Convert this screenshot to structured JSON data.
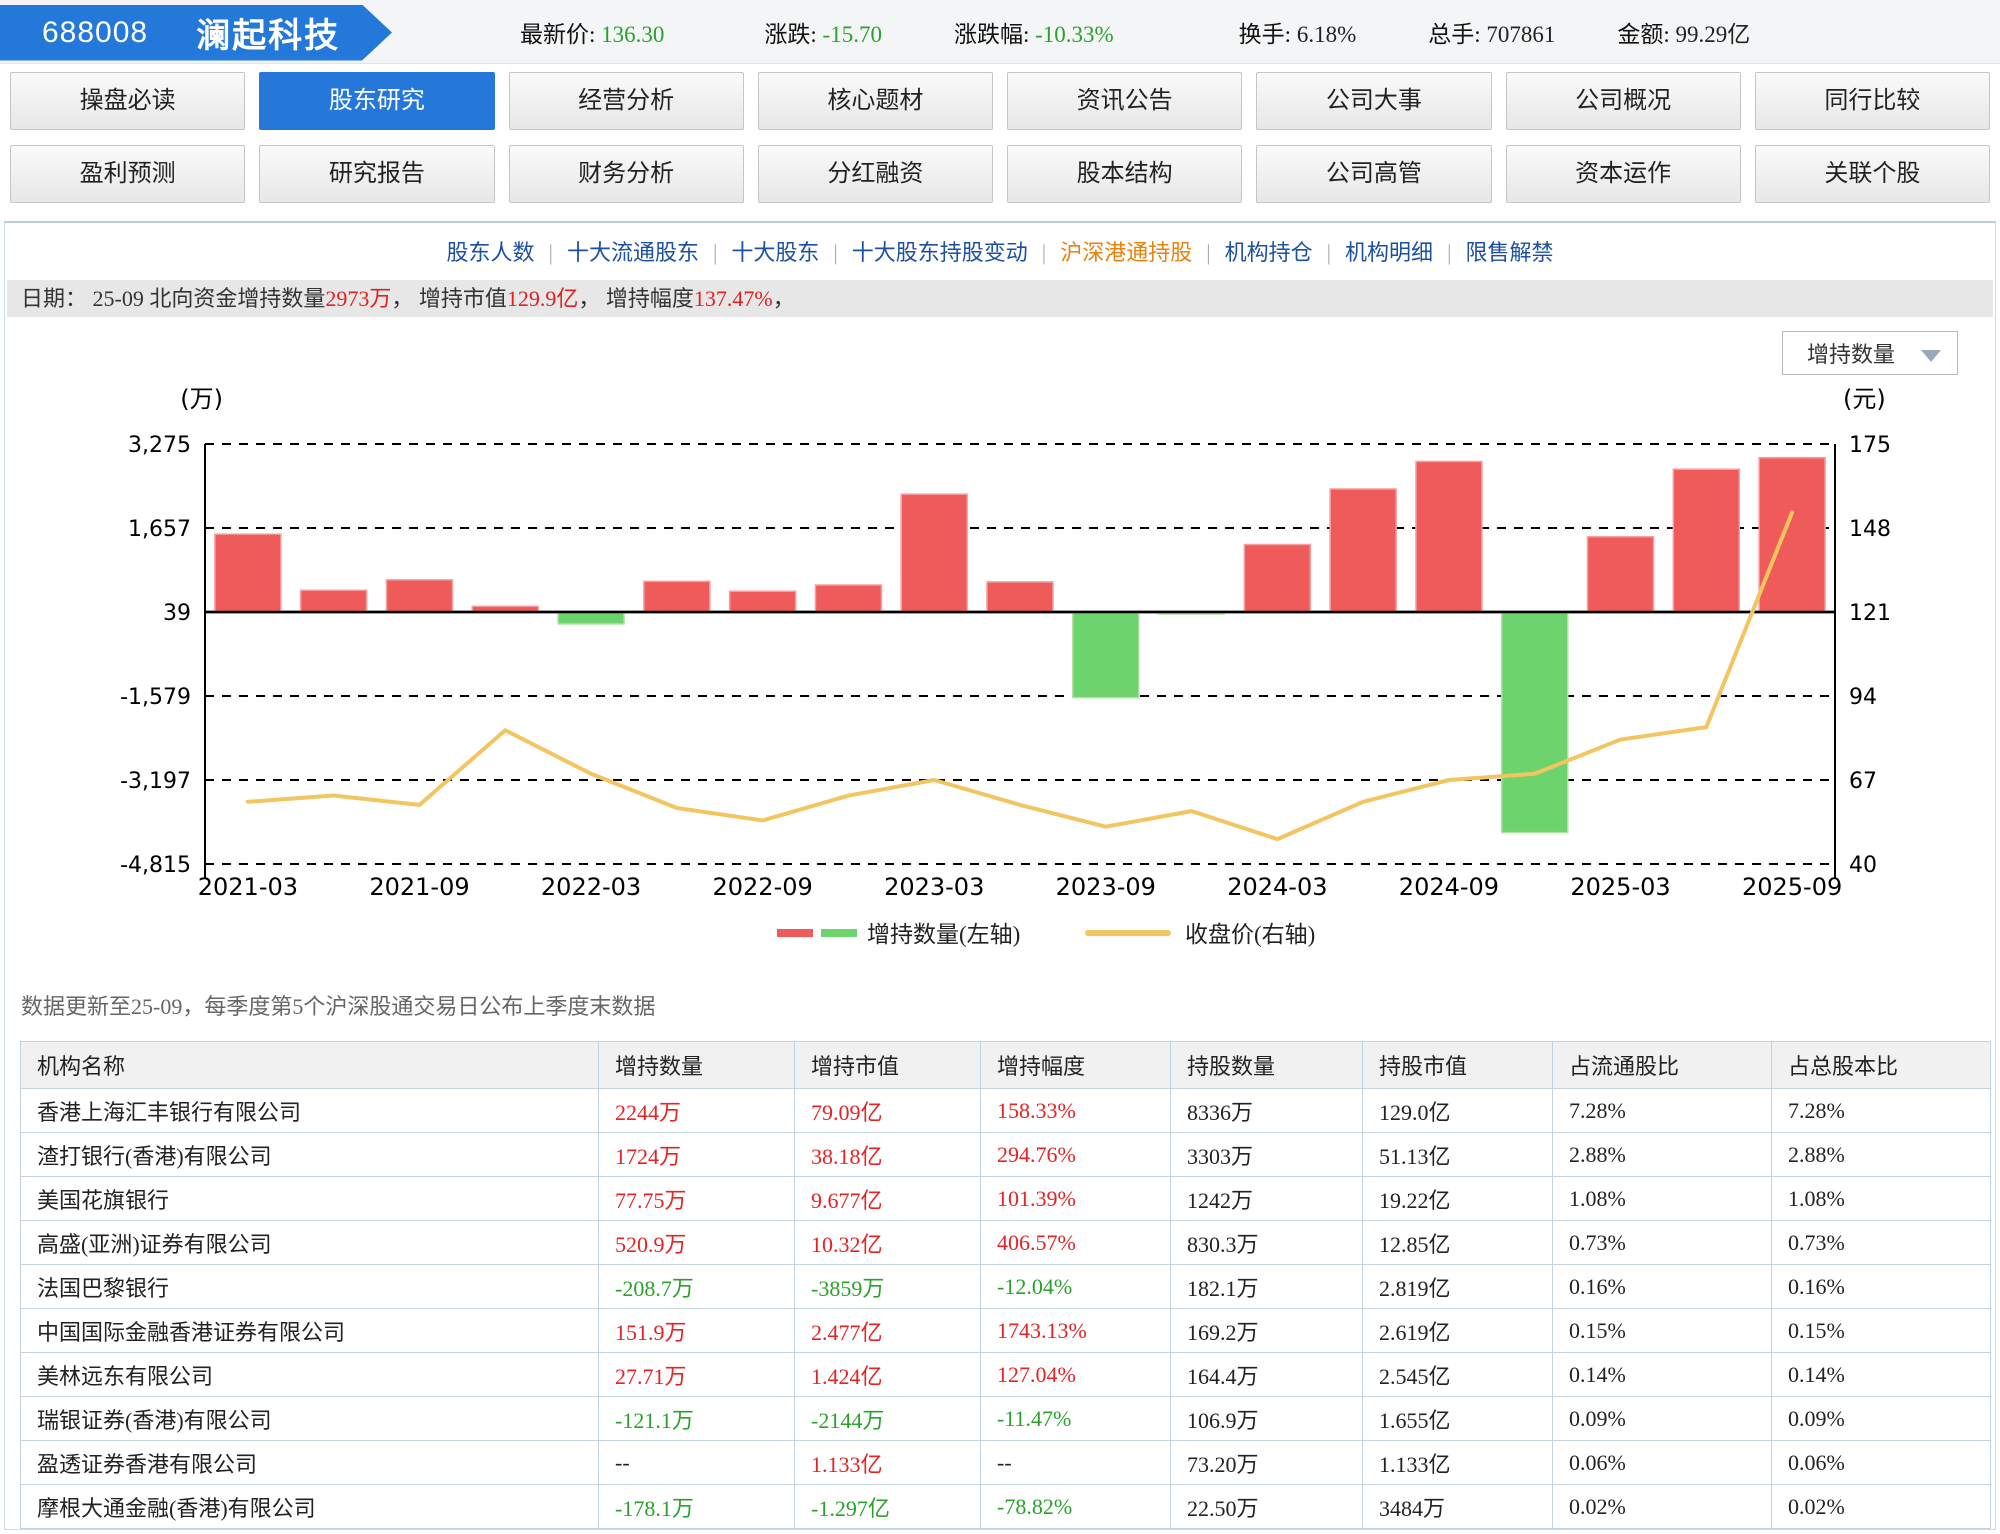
{
  "header": {
    "code": "688008",
    "name": "澜起科技",
    "stats": [
      {
        "label": "最新价:",
        "value": "136.30",
        "color": "green"
      },
      {
        "label": "涨跌:",
        "value": "-15.70",
        "color": "green"
      },
      {
        "label": "涨跌幅:",
        "value": "-10.33%",
        "color": "green"
      },
      {
        "label": "换手:",
        "value": "6.18%",
        "color": "dark"
      },
      {
        "label": "总手:",
        "value": "707861",
        "color": "dark"
      },
      {
        "label": "金额:",
        "value": "99.29亿",
        "color": "dark"
      }
    ]
  },
  "nav": {
    "items": [
      "操盘必读",
      "股东研究",
      "经营分析",
      "核心题材",
      "资讯公告",
      "公司大事",
      "公司概况",
      "同行比较",
      "盈利预测",
      "研究报告",
      "财务分析",
      "分红融资",
      "股本结构",
      "公司高管",
      "资本运作",
      "关联个股"
    ],
    "active": "股东研究"
  },
  "subnav": {
    "items": [
      "股东人数",
      "十大流通股东",
      "十大股东",
      "十大股东持股变动",
      "沪深港通持股",
      "机构持仓",
      "机构明细",
      "限售解禁"
    ],
    "active": "沪深港通持股"
  },
  "info_bar": {
    "parts": [
      {
        "t": "日期： 25-09 北向资金增持数量",
        "c": "dark"
      },
      {
        "t": "2973万",
        "c": "red"
      },
      {
        "t": "， 增持市值",
        "c": "dark"
      },
      {
        "t": "129.9亿",
        "c": "red"
      },
      {
        "t": "， 增持幅度",
        "c": "dark"
      },
      {
        "t": "137.47%",
        "c": "red"
      },
      {
        "t": "，",
        "c": "dark"
      }
    ]
  },
  "dropdown": {
    "value": "增持数量"
  },
  "chart_data": {
    "type": "bar+line",
    "title": "北向资金增持数量与收盘价",
    "categories": [
      "2021-03",
      "2021-06",
      "2021-09",
      "2021-12",
      "2022-03",
      "2022-06",
      "2022-09",
      "2022-12",
      "2023-03",
      "2023-06",
      "2023-09",
      "2023-12",
      "2024-03",
      "2024-06",
      "2024-09",
      "2024-12",
      "2025-03",
      "2025-06",
      "2025-09"
    ],
    "series": [
      {
        "name": "增持数量(左轴)",
        "type": "bar",
        "axis": "left",
        "unit": "万",
        "values": [
          1500,
          420,
          620,
          110,
          -230,
          590,
          400,
          520,
          2270,
          580,
          -1650,
          -30,
          1300,
          2370,
          2900,
          -4250,
          1450,
          2750,
          2973
        ]
      },
      {
        "name": "收盘价(右轴)",
        "type": "line",
        "axis": "right",
        "unit": "元",
        "values": [
          60,
          62,
          59,
          83,
          69,
          58,
          54,
          62,
          67,
          59,
          52,
          57,
          48,
          60,
          67,
          69,
          80,
          84,
          153
        ]
      }
    ],
    "left_axis": {
      "unit": "(万)",
      "ticks": [
        3275,
        1657,
        39,
        -1579,
        -3197,
        -4815
      ]
    },
    "right_axis": {
      "unit": "(元)",
      "ticks": [
        175,
        148,
        121,
        94,
        67,
        40
      ]
    },
    "x_tick_labels": [
      "2021-03",
      "2021-09",
      "2022-03",
      "2022-09",
      "2023-03",
      "2023-09",
      "2024-03",
      "2024-09",
      "2025-03",
      "2025-09"
    ],
    "legend": [
      "增持数量(左轴)",
      "收盘价(右轴)"
    ],
    "legend_position": "bottom-center",
    "grid": "dashed-horizontal",
    "colors": {
      "bar_up": "#ef5b5b",
      "bar_up_edge": "#f5a0a0",
      "bar_down": "#6dd36d",
      "bar_down_edge": "#aee3a0",
      "line": "#f3c561"
    }
  },
  "note": "数据更新至25-09，每季度第5个沪深股通交易日公布上季度末数据",
  "table": {
    "headers": [
      "机构名称",
      "增持数量",
      "增持市值",
      "增持幅度",
      "持股数量",
      "持股市值",
      "占流通股比",
      "占总股本比"
    ],
    "rows": [
      {
        "name": "香港上海汇丰银行有限公司",
        "cells": [
          {
            "v": "2244万",
            "c": "red"
          },
          {
            "v": "79.09亿",
            "c": "red"
          },
          {
            "v": "158.33%",
            "c": "red"
          },
          {
            "v": "8336万",
            "c": "dark"
          },
          {
            "v": "129.0亿",
            "c": "dark"
          },
          {
            "v": "7.28%",
            "c": "dark"
          },
          {
            "v": "7.28%",
            "c": "dark"
          }
        ]
      },
      {
        "name": "渣打银行(香港)有限公司",
        "cells": [
          {
            "v": "1724万",
            "c": "red"
          },
          {
            "v": "38.18亿",
            "c": "red"
          },
          {
            "v": "294.76%",
            "c": "red"
          },
          {
            "v": "3303万",
            "c": "dark"
          },
          {
            "v": "51.13亿",
            "c": "dark"
          },
          {
            "v": "2.88%",
            "c": "dark"
          },
          {
            "v": "2.88%",
            "c": "dark"
          }
        ]
      },
      {
        "name": "美国花旗银行",
        "cells": [
          {
            "v": "77.75万",
            "c": "red"
          },
          {
            "v": "9.677亿",
            "c": "red"
          },
          {
            "v": "101.39%",
            "c": "red"
          },
          {
            "v": "1242万",
            "c": "dark"
          },
          {
            "v": "19.22亿",
            "c": "dark"
          },
          {
            "v": "1.08%",
            "c": "dark"
          },
          {
            "v": "1.08%",
            "c": "dark"
          }
        ]
      },
      {
        "name": "高盛(亚洲)证券有限公司",
        "cells": [
          {
            "v": "520.9万",
            "c": "red"
          },
          {
            "v": "10.32亿",
            "c": "red"
          },
          {
            "v": "406.57%",
            "c": "red"
          },
          {
            "v": "830.3万",
            "c": "dark"
          },
          {
            "v": "12.85亿",
            "c": "dark"
          },
          {
            "v": "0.73%",
            "c": "dark"
          },
          {
            "v": "0.73%",
            "c": "dark"
          }
        ]
      },
      {
        "name": "法国巴黎银行",
        "cells": [
          {
            "v": "-208.7万",
            "c": "green"
          },
          {
            "v": "-3859万",
            "c": "green"
          },
          {
            "v": "-12.04%",
            "c": "green"
          },
          {
            "v": "182.1万",
            "c": "dark"
          },
          {
            "v": "2.819亿",
            "c": "dark"
          },
          {
            "v": "0.16%",
            "c": "dark"
          },
          {
            "v": "0.16%",
            "c": "dark"
          }
        ]
      },
      {
        "name": "中国国际金融香港证券有限公司",
        "cells": [
          {
            "v": "151.9万",
            "c": "red"
          },
          {
            "v": "2.477亿",
            "c": "red"
          },
          {
            "v": "1743.13%",
            "c": "red"
          },
          {
            "v": "169.2万",
            "c": "dark"
          },
          {
            "v": "2.619亿",
            "c": "dark"
          },
          {
            "v": "0.15%",
            "c": "dark"
          },
          {
            "v": "0.15%",
            "c": "dark"
          }
        ]
      },
      {
        "name": "美林远东有限公司",
        "cells": [
          {
            "v": "27.71万",
            "c": "red"
          },
          {
            "v": "1.424亿",
            "c": "red"
          },
          {
            "v": "127.04%",
            "c": "red"
          },
          {
            "v": "164.4万",
            "c": "dark"
          },
          {
            "v": "2.545亿",
            "c": "dark"
          },
          {
            "v": "0.14%",
            "c": "dark"
          },
          {
            "v": "0.14%",
            "c": "dark"
          }
        ]
      },
      {
        "name": "瑞银证券(香港)有限公司",
        "cells": [
          {
            "v": "-121.1万",
            "c": "green"
          },
          {
            "v": "-2144万",
            "c": "green"
          },
          {
            "v": "-11.47%",
            "c": "green"
          },
          {
            "v": "106.9万",
            "c": "dark"
          },
          {
            "v": "1.655亿",
            "c": "dark"
          },
          {
            "v": "0.09%",
            "c": "dark"
          },
          {
            "v": "0.09%",
            "c": "dark"
          }
        ]
      },
      {
        "name": "盈透证券香港有限公司",
        "cells": [
          {
            "v": "--",
            "c": "dark"
          },
          {
            "v": "1.133亿",
            "c": "red"
          },
          {
            "v": "--",
            "c": "dark"
          },
          {
            "v": "73.20万",
            "c": "dark"
          },
          {
            "v": "1.133亿",
            "c": "dark"
          },
          {
            "v": "0.06%",
            "c": "dark"
          },
          {
            "v": "0.06%",
            "c": "dark"
          }
        ]
      },
      {
        "name": "摩根大通金融(香港)有限公司",
        "cells": [
          {
            "v": "-178.1万",
            "c": "green"
          },
          {
            "v": "-1.297亿",
            "c": "green"
          },
          {
            "v": "-78.82%",
            "c": "green"
          },
          {
            "v": "22.50万",
            "c": "dark"
          },
          {
            "v": "3484万",
            "c": "dark"
          },
          {
            "v": "0.02%",
            "c": "dark"
          },
          {
            "v": "0.02%",
            "c": "dark"
          }
        ]
      }
    ]
  }
}
